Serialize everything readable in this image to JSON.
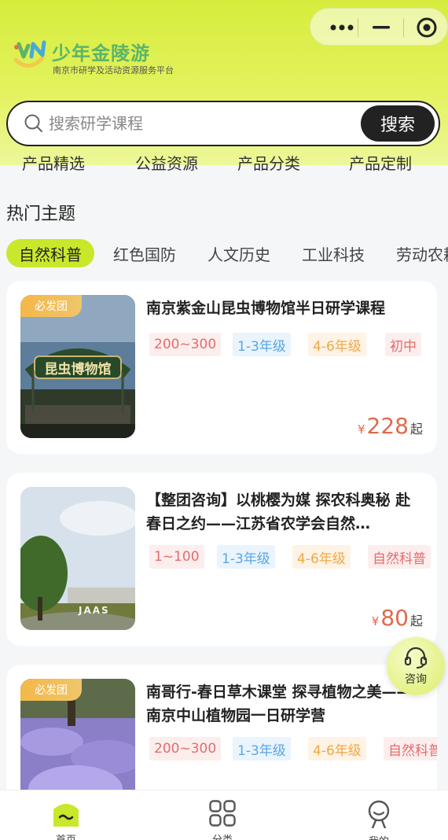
{
  "app": {
    "name": "少年金陵游",
    "subtitle": "南京市研学及活动资源服务平台"
  },
  "capsule": {
    "more_icon": "more-dots-icon",
    "minimize_icon": "minimize-icon",
    "close_icon": "target-circle-icon"
  },
  "search": {
    "placeholder": "搜索研学课程",
    "button_label": "搜索"
  },
  "categories": [
    "产品精选",
    "公益资源",
    "产品分类",
    "产品定制"
  ],
  "section": {
    "title": "热门主题"
  },
  "tabs": [
    "自然科普",
    "红色国防",
    "人文历史",
    "工业科技",
    "劳动农耕"
  ],
  "cards": [
    {
      "badge": "必发团",
      "title": "南京紫金山昆虫博物馆半日研学课程",
      "tags": [
        "200~300",
        "1-3年级",
        "4-6年级",
        "初中"
      ],
      "price_currency": "¥",
      "price": "228",
      "price_suffix": "起",
      "image_text": "昆虫博物馆"
    },
    {
      "badge": "",
      "title": "【整团咨询】以桃樱为媒 探农科奥秘 赴春日之约——江苏省农学会自然…",
      "tags": [
        "1~100",
        "1-3年级",
        "4-6年级",
        "自然科普"
      ],
      "price_currency": "¥",
      "price": "80",
      "price_suffix": "起",
      "image_text": "JAAS"
    },
    {
      "badge": "必发团",
      "title": "南哥行-春日草木课堂 探寻植物之美——南京中山植物园一日研学营",
      "tags": [
        "200~300",
        "1-3年级",
        "4-6年级",
        "自然科普"
      ],
      "price_currency": "¥",
      "price": "",
      "price_suffix": "",
      "image_text": ""
    }
  ],
  "consult": {
    "label": "咨询",
    "icon": "headset-icon"
  },
  "tabbar": [
    {
      "label": "首页",
      "icon": "home-icon"
    },
    {
      "label": "分类",
      "icon": "grid-icon"
    },
    {
      "label": "我的",
      "icon": "profile-icon"
    }
  ],
  "colors": {
    "accent": "#c9e72b",
    "price": "#e06a4c",
    "brand_green": "#5bb46a"
  }
}
